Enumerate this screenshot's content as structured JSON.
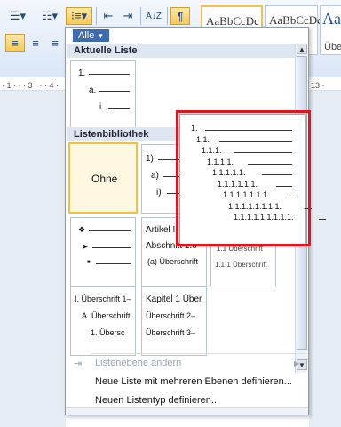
{
  "ribbon": {
    "style1": "AaBbCcDc",
    "style2": "AaBbCcDc",
    "style3": "Aa",
    "style_sub": "Übe",
    "pilcrow": "¶",
    "sort": "A↓Z"
  },
  "ruler": {
    "left_marks": "· 1 · · · 3 · · · 4 ·",
    "right_mark": "13 ·"
  },
  "panel": {
    "filter_label": "Alle",
    "section_current": "Aktuelle Liste",
    "section_library": "Listenbibliothek",
    "current_list": [
      "1.",
      "a.",
      "i."
    ],
    "none_label": "Ohne",
    "tile_numbered": [
      "1)",
      "a)",
      "i)"
    ],
    "tile_bullets": [
      "❖",
      "➤",
      "■"
    ],
    "tile_article": [
      "Artikel I.",
      "Abschnitt 1.0",
      "(a) Überschrift"
    ],
    "tile_decimal_partial": [
      "1.1 Überschrift",
      "1.1.1 Überschrift"
    ],
    "tile_headings_roman": [
      "I. Überschrift 1–",
      "A. Überschrift",
      "1. Übersc"
    ],
    "tile_chapter": [
      "Kapitel 1 Über",
      "Überschrift 2–",
      "Überschrift 3–"
    ],
    "menu_change_level": "Listenebene ändern",
    "menu_define_multilevel": "Neue Liste mit mehreren Ebenen definieren...",
    "menu_define_style": "Neuen Listentyp definieren..."
  },
  "preview": {
    "levels": [
      "1.",
      "1.1.",
      "1.1.1.",
      "1.1.1.1.",
      "1.1.1.1.1.",
      "1.1.1.1.1.1.",
      "1.1.1.1.1.1.1.",
      "1.1.1.1.1.1.1.1.",
      "1.1.1.1.1.1.1.1.1."
    ]
  }
}
